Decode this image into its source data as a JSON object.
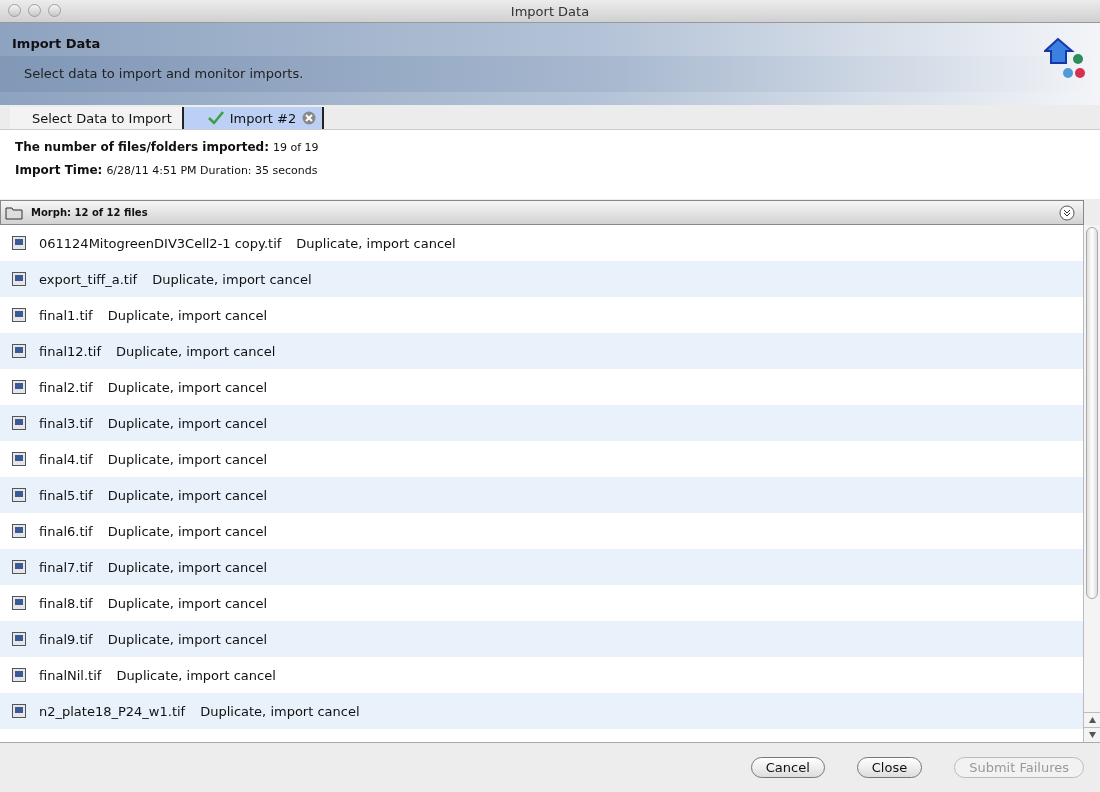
{
  "window": {
    "title": "Import Data"
  },
  "header": {
    "title": "Import Data",
    "subtitle": "Select data to import and monitor imports."
  },
  "tabs": [
    {
      "label": "Select Data to Import",
      "selected": false,
      "kind": "plain"
    },
    {
      "label": "Import #2",
      "selected": true,
      "kind": "import"
    }
  ],
  "summary": [
    {
      "label": "The number of files/folders imported:",
      "value": "19 of 19"
    },
    {
      "label": "Import Time:",
      "value": "6/28/11 4:51 PM Duration:  35 seconds"
    }
  ],
  "group": {
    "title": "Morph: 12 of 12 files"
  },
  "files": [
    {
      "name": "061124MitogreenDIV3Cell2-1 copy.tif",
      "status": "Duplicate, import cancel"
    },
    {
      "name": "export_tiff_a.tif",
      "status": "Duplicate, import cancel"
    },
    {
      "name": "final1.tif",
      "status": "Duplicate, import cancel"
    },
    {
      "name": "final12.tif",
      "status": "Duplicate, import cancel"
    },
    {
      "name": "final2.tif",
      "status": "Duplicate, import cancel"
    },
    {
      "name": "final3.tif",
      "status": "Duplicate, import cancel"
    },
    {
      "name": "final4.tif",
      "status": "Duplicate, import cancel"
    },
    {
      "name": "final5.tif",
      "status": "Duplicate, import cancel"
    },
    {
      "name": "final6.tif",
      "status": "Duplicate, import cancel"
    },
    {
      "name": "final7.tif",
      "status": "Duplicate, import cancel"
    },
    {
      "name": "final8.tif",
      "status": "Duplicate, import cancel"
    },
    {
      "name": "final9.tif",
      "status": "Duplicate, import cancel"
    },
    {
      "name": "finalNil.tif",
      "status": "Duplicate, import cancel"
    },
    {
      "name": "n2_plate18_P24_w1.tif",
      "status": "Duplicate, import cancel"
    }
  ],
  "buttons": [
    {
      "label": "Cancel",
      "disabled": false
    },
    {
      "label": "Close",
      "disabled": false
    },
    {
      "label": "Submit Failures",
      "disabled": true
    }
  ]
}
